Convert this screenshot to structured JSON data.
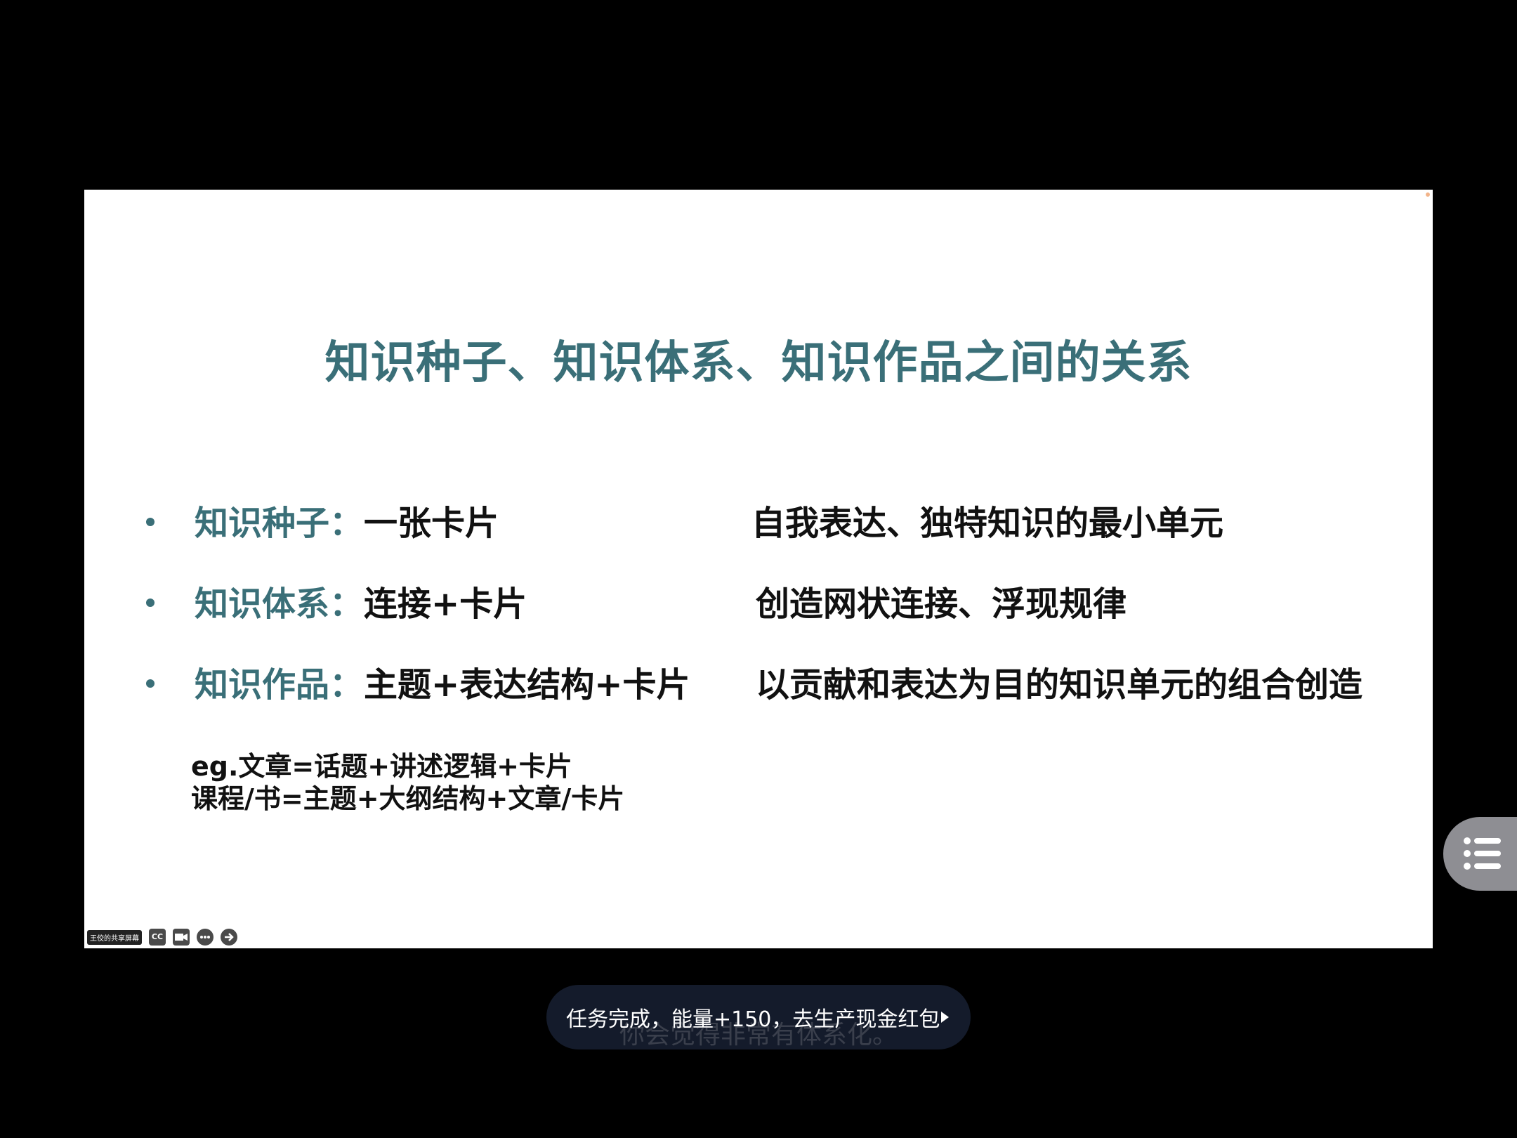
{
  "slide": {
    "title": "知识种子、知识体系、知识作品之间的关系",
    "bullets": [
      {
        "term": "知识种子：",
        "formula": "一张卡片",
        "description": "自我表达、独特知识的最小单元"
      },
      {
        "term": "知识体系：",
        "formula": "连接+卡片",
        "description": "创造网状连接、浮现规律"
      },
      {
        "term": "知识作品：",
        "formula": "主题+表达结构+卡片",
        "description": "以贡献和表达为目的知识单元的组合创造"
      }
    ],
    "examples": [
      "eg.文章=话题+讲述逻辑+卡片",
      "课程/书=主题+大纲结构+文章/卡片"
    ],
    "colors": {
      "accent": "#3a6f78",
      "text": "#111111",
      "background": "#ffffff"
    }
  },
  "meeting_toolbar": {
    "share_label": "王佼的共享屏幕",
    "icons": [
      "cc-icon",
      "camera-icon",
      "more-icon",
      "arrow-right-icon"
    ],
    "cc_text": "CC"
  },
  "toast": {
    "text": "任务完成，能量+150，去生产现金红包",
    "caption_behind": "你会觉得非常有体系化。"
  },
  "floating_list_button": {
    "icon": "list-icon"
  }
}
